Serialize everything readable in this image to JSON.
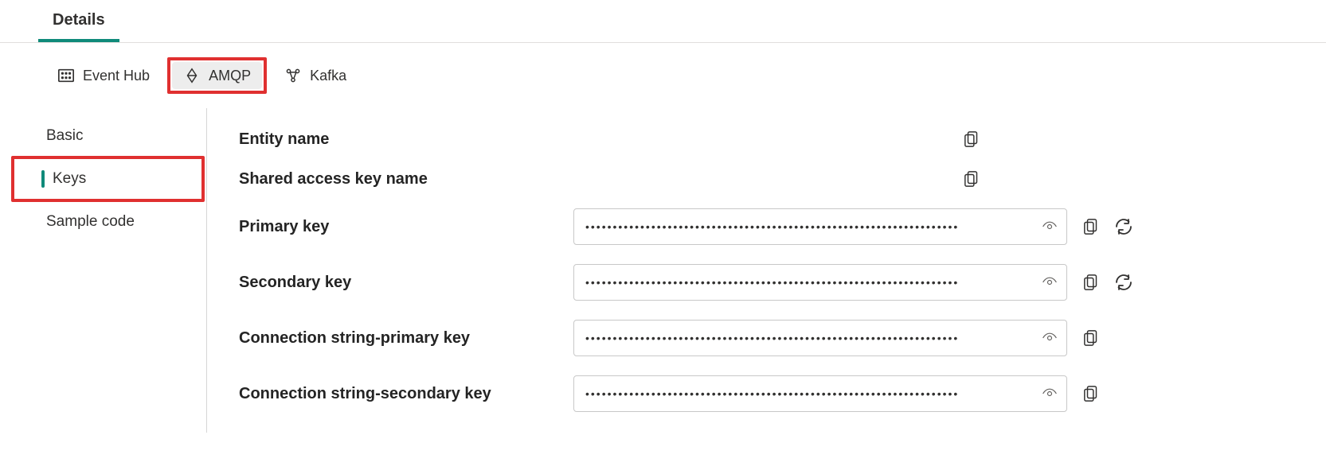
{
  "tabs_top": {
    "details": "Details"
  },
  "protocols": [
    {
      "id": "eventhub",
      "label": "Event Hub"
    },
    {
      "id": "amqp",
      "label": "AMQP"
    },
    {
      "id": "kafka",
      "label": "Kafka"
    }
  ],
  "side_nav": [
    {
      "id": "basic",
      "label": "Basic"
    },
    {
      "id": "keys",
      "label": "Keys"
    },
    {
      "id": "sample",
      "label": "Sample code"
    }
  ],
  "fields": {
    "entity_name": {
      "label": "Entity name",
      "value": ""
    },
    "shared_access_key_name": {
      "label": "Shared access key name",
      "value": ""
    },
    "primary_key": {
      "label": "Primary key",
      "masked": true
    },
    "secondary_key": {
      "label": "Secondary key",
      "masked": true
    },
    "conn_primary": {
      "label": "Connection string-primary key",
      "masked": true
    },
    "conn_secondary": {
      "label": "Connection string-secondary key",
      "masked": true
    }
  },
  "mask": "••••••••••••••••••••••••••••••••••••••••••••••••••••••••••••••••••••"
}
